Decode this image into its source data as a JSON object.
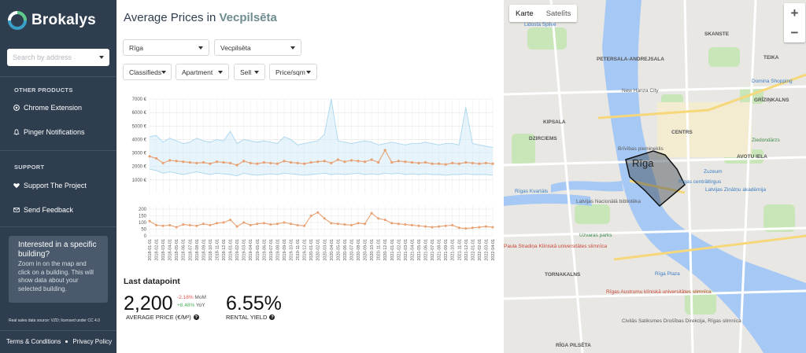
{
  "app": {
    "brand": "Brokalys"
  },
  "sidebar": {
    "search_placeholder": "Search by address",
    "other_products_title": "OTHER PRODUCTS",
    "other_products": [
      {
        "label": "Chrome Extension",
        "icon": "chrome-icon"
      },
      {
        "label": "Pinger Notifications",
        "icon": "bell-icon"
      }
    ],
    "support_title": "SUPPORT",
    "support": [
      {
        "label": "Support The Project",
        "icon": "heart-icon"
      },
      {
        "label": "Send Feedback",
        "icon": "envelope-icon"
      }
    ],
    "info_card": {
      "title": "Interested in a specific building?",
      "body": "Zoom in on the map and click on a building. This will show data about your selected building."
    },
    "data_source": "Real sales data source: VZD; licensed under CC 4.0",
    "terms": "Terms & Conditions",
    "privacy": "Privacy Policy"
  },
  "main": {
    "title_prefix": "Average Prices in",
    "title_location": "Vecpilsēta",
    "filters": {
      "city": "Rīga",
      "district": "Vecpilsēta",
      "source": "Classifieds",
      "type": "Apartment",
      "deal": "Sell",
      "metric": "Price/sqm"
    },
    "last_datapoint": {
      "title": "Last datapoint",
      "average_price": "2,200",
      "mom": "-2.18%",
      "mom_label": "MoM",
      "yoy": "+8.48%",
      "yoy_label": "YoY",
      "average_price_label": "AVERAGE PRICE (€/M²)",
      "rental_yield": "6.55%",
      "rental_yield_label": "RENTAL YIELD"
    }
  },
  "chart_data": {
    "type": "line",
    "x_ticks": [
      "2018-01-01",
      "2018-02-01",
      "2018-03-01",
      "2018-04-01",
      "2018-05-01",
      "2018-06-01",
      "2018-07-01",
      "2018-08-01",
      "2018-09-01",
      "2018-10-01",
      "2018-11-01",
      "2018-12-01",
      "2019-01-01",
      "2019-02-01",
      "2019-03-01",
      "2019-04-01",
      "2019-05-01",
      "2019-06-01",
      "2019-07-01",
      "2019-08-01",
      "2019-09-01",
      "2019-10-01",
      "2019-11-01",
      "2019-12-01",
      "2020-01-01",
      "2020-02-01",
      "2020-03-01",
      "2020-04-01",
      "2020-05-01",
      "2020-06-01",
      "2020-07-01",
      "2020-08-01",
      "2020-09-01",
      "2020-10-01",
      "2020-11-01",
      "2020-12-01",
      "2021-01-01",
      "2021-02-01",
      "2021-03-01",
      "2021-04-01",
      "2021-05-01",
      "2021-06-01",
      "2021-07-01",
      "2021-08-01",
      "2021-09-01",
      "2021-10-01",
      "2021-11-01",
      "2021-12-01",
      "2022-01-01",
      "2022-02-01",
      "2022-03-01",
      "2022-04-01"
    ],
    "price_panel": {
      "y_ticks": [
        "1000 €",
        "2000 €",
        "3000 €",
        "4000 €",
        "5000 €",
        "6000 €",
        "7000 €"
      ],
      "ylim": [
        0,
        7000
      ],
      "price": [
        2750,
        2600,
        2250,
        2450,
        2400,
        2350,
        2300,
        2250,
        2300,
        2200,
        2350,
        2300,
        2250,
        2100,
        2400,
        2250,
        2200,
        2300,
        2250,
        2200,
        2400,
        2300,
        2250,
        2200,
        2300,
        2350,
        2400,
        2250,
        2500,
        2350,
        2450,
        2400,
        2350,
        2500,
        2300,
        3200,
        2300,
        2400,
        2350,
        2300,
        2250,
        2300,
        2200,
        2200,
        2150,
        2250,
        2200,
        2300,
        2250,
        2200,
        2250,
        2200
      ],
      "upper": [
        4200,
        4300,
        3800,
        4100,
        3900,
        3700,
        3800,
        4100,
        3900,
        3800,
        4000,
        3900,
        4600,
        3700,
        4000,
        3900,
        3800,
        3900,
        3800,
        3700,
        4200,
        4000,
        3600,
        3700,
        3800,
        3900,
        4400,
        7000,
        3900,
        3800,
        3700,
        3800,
        3900,
        3800,
        3600,
        3700,
        3800,
        3700,
        3600,
        3700,
        3700,
        3800,
        3700,
        3600,
        3700,
        3700,
        3600,
        6400,
        3700,
        3600,
        3500,
        3400
      ],
      "lower": [
        1800,
        1700,
        1500,
        1600,
        1500,
        1400,
        1500,
        1600,
        1500,
        1400,
        1500,
        1450,
        1400,
        1300,
        1500,
        1400,
        1350,
        1400,
        1450,
        1400,
        1500,
        1450,
        1400,
        1350,
        1400,
        1450,
        1500,
        1400,
        1450,
        1400,
        1450,
        1500,
        1400,
        1450,
        1400,
        1500,
        1450,
        1500,
        1400,
        1450,
        1400,
        1450,
        1400,
        1400,
        1350,
        1400,
        1400,
        1450,
        1400,
        1400,
        1400,
        1350
      ]
    },
    "count_panel": {
      "y_ticks": [
        "0",
        "50",
        "100",
        "150",
        "200"
      ],
      "ylim": [
        0,
        200
      ],
      "values": [
        110,
        80,
        75,
        80,
        65,
        85,
        80,
        75,
        90,
        80,
        95,
        100,
        120,
        70,
        100,
        80,
        90,
        95,
        85,
        90,
        100,
        90,
        80,
        75,
        150,
        175,
        130,
        95,
        90,
        85,
        80,
        95,
        90,
        170,
        130,
        120,
        95,
        90,
        85,
        80,
        75,
        70,
        65,
        70,
        75,
        80,
        60,
        55,
        60,
        65,
        70,
        65
      ]
    },
    "colors": {
      "price": "#e8a071",
      "band": "#a9d6ef",
      "band_fill": "#cfe9f8"
    }
  },
  "map": {
    "btn_map": "Karte",
    "btn_satellite": "Satelīts",
    "zoom_in": "+",
    "zoom_out": "−",
    "selected_label": "Rīga",
    "labels": [
      {
        "text": "Lidosta Spilve",
        "cls": "blue"
      },
      {
        "text": "PETERSALA-ANDREJSALA",
        "cls": "bold"
      },
      {
        "text": "AVOTU IELA",
        "cls": "bold"
      },
      {
        "text": "New Hanza City",
        "cls": ""
      },
      {
        "text": "KIPSALA",
        "cls": "bold"
      },
      {
        "text": "CENTRS",
        "cls": "bold"
      },
      {
        "text": "DZIRCIEMS",
        "cls": "bold"
      },
      {
        "text": "Ziedondārzs",
        "cls": "green"
      },
      {
        "text": "Zuzeum",
        "cls": "blue"
      },
      {
        "text": "Latvijas Nacionālā bibliotēka",
        "cls": ""
      },
      {
        "text": "Latvijas Zinātņu akadēmija",
        "cls": "blue"
      },
      {
        "text": "Uzvaras parks",
        "cls": "green"
      },
      {
        "text": "Rīgas Kvartāls",
        "cls": "blue"
      },
      {
        "text": "Paula Stradiņa Klīniskā universitātes slimnīca",
        "cls": "red"
      },
      {
        "text": "TORNAKALNS",
        "cls": "bold"
      },
      {
        "text": "Rīga Plaza",
        "cls": "blue"
      },
      {
        "text": "Rīgas Austrumu klīniskā universitātes slimnīca",
        "cls": "red"
      },
      {
        "text": "Civilās Satiksmes Drošības Direkcija, Rīgas slimnīca",
        "cls": ""
      },
      {
        "text": "RĪGA PILSĒTA",
        "cls": "bold"
      },
      {
        "text": "GRĪZIŅKALNS",
        "cls": "bold"
      },
      {
        "text": "Domina Shopping",
        "cls": "blue"
      },
      {
        "text": "TEIKA",
        "cls": "bold"
      },
      {
        "text": "SKANSTE",
        "cls": "bold"
      },
      {
        "text": "Rīgas centrāltirgus",
        "cls": "blue"
      },
      {
        "text": "Brīvības piemineklis",
        "cls": ""
      }
    ]
  }
}
